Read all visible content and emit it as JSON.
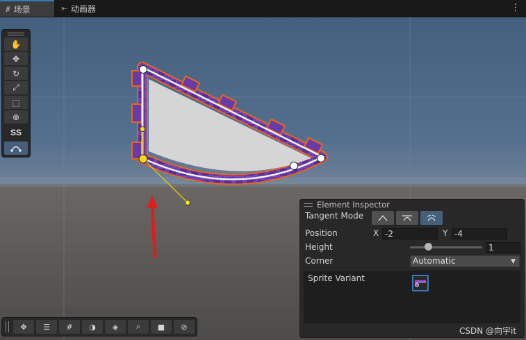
{
  "tabs": [
    {
      "label": "场景",
      "icon": "grid-icon",
      "active": true
    },
    {
      "label": "动画器",
      "icon": "animator-icon",
      "active": false
    }
  ],
  "toolbar": {
    "tools": [
      "hand-tool",
      "move-tool",
      "rotate-tool",
      "scale-tool",
      "rect-tool",
      "transform-tool"
    ],
    "custom_label": "SS",
    "active_tool": "spline-edit-tool"
  },
  "bottom_toolbar": {
    "buttons": [
      "move-gizmo",
      "snap-settings",
      "grid-visibility",
      "shading-mode",
      "layers",
      "search",
      "camera",
      "compass"
    ]
  },
  "inspector": {
    "title": "Element Inspector",
    "tangent_mode_label": "Tangent Mode",
    "tangent_modes": [
      "linear",
      "continuous",
      "broken"
    ],
    "tangent_mode_selected": "broken",
    "position_label": "Position",
    "x_label": "X",
    "x_value": "-2",
    "y_label": "Y",
    "y_value": "-4",
    "height_label": "Height",
    "height_value": "1",
    "height_slider_fraction": 0.25,
    "corner_label": "Corner",
    "corner_value": "Automatic",
    "sprite_variant_label": "Sprite Variant"
  },
  "watermark": "CSDN @向宇it",
  "colors": {
    "sky": "#4a6583",
    "ground": "#585552",
    "shape_fill": "#d5d5d5",
    "tiles": "#6d3ea8",
    "outline": "#e8661b",
    "selection_blue": "#3a79bb",
    "arrow": "#e01c1c"
  }
}
